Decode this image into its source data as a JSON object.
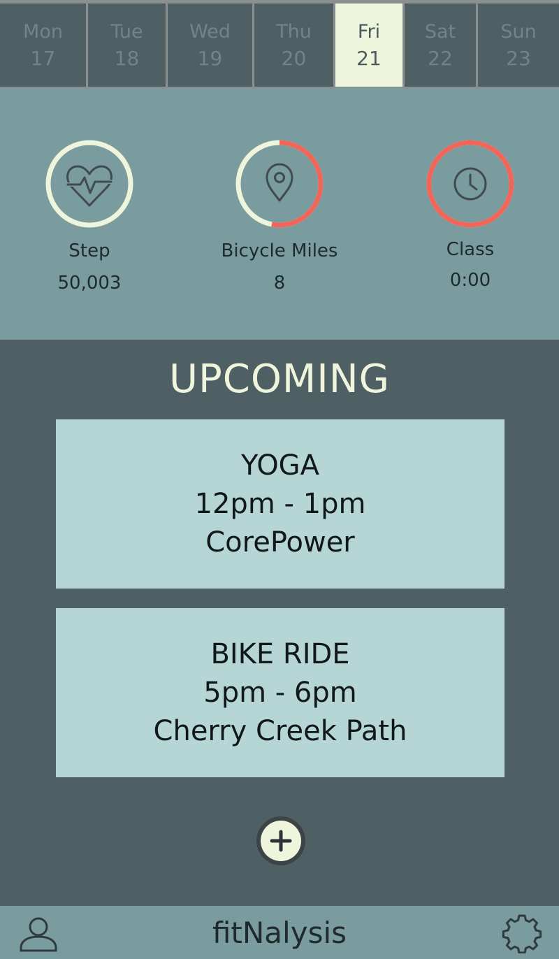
{
  "days": [
    {
      "name": "Mon",
      "num": "17"
    },
    {
      "name": "Tue",
      "num": "18"
    },
    {
      "name": "Wed",
      "num": "19"
    },
    {
      "name": "Thu",
      "num": "20"
    },
    {
      "name": "Fri",
      "num": "21"
    },
    {
      "name": "Sat",
      "num": "22"
    },
    {
      "name": "Sun",
      "num": "23"
    }
  ],
  "selected_day": "Fri",
  "stats": {
    "step": {
      "label": "Step",
      "value": "50,003",
      "icon": "heartbeat-icon",
      "progress": 0
    },
    "bike": {
      "label": "Bicycle Miles",
      "value": "8",
      "icon": "location-pin-icon",
      "progress": 0.53
    },
    "class": {
      "label": "Class",
      "value": "0:00",
      "icon": "clock-icon",
      "progress": 1.0
    }
  },
  "upcoming": {
    "title": "UPCOMING",
    "events": [
      {
        "name": "YOGA",
        "time": "12pm - 1pm",
        "place": "CorePower"
      },
      {
        "name": "BIKE RIDE",
        "time": "5pm - 6pm",
        "place": "Cherry Creek Path"
      }
    ],
    "add_icon": "plus-icon"
  },
  "footer": {
    "brand": "fitNalysis",
    "left_icon": "user-icon",
    "right_icon": "gear-icon"
  },
  "colors": {
    "ring_base": "#eef5dc",
    "ring_progress": "#f0665a",
    "accent": "#eef5dc",
    "card": "#b6d6d6"
  }
}
